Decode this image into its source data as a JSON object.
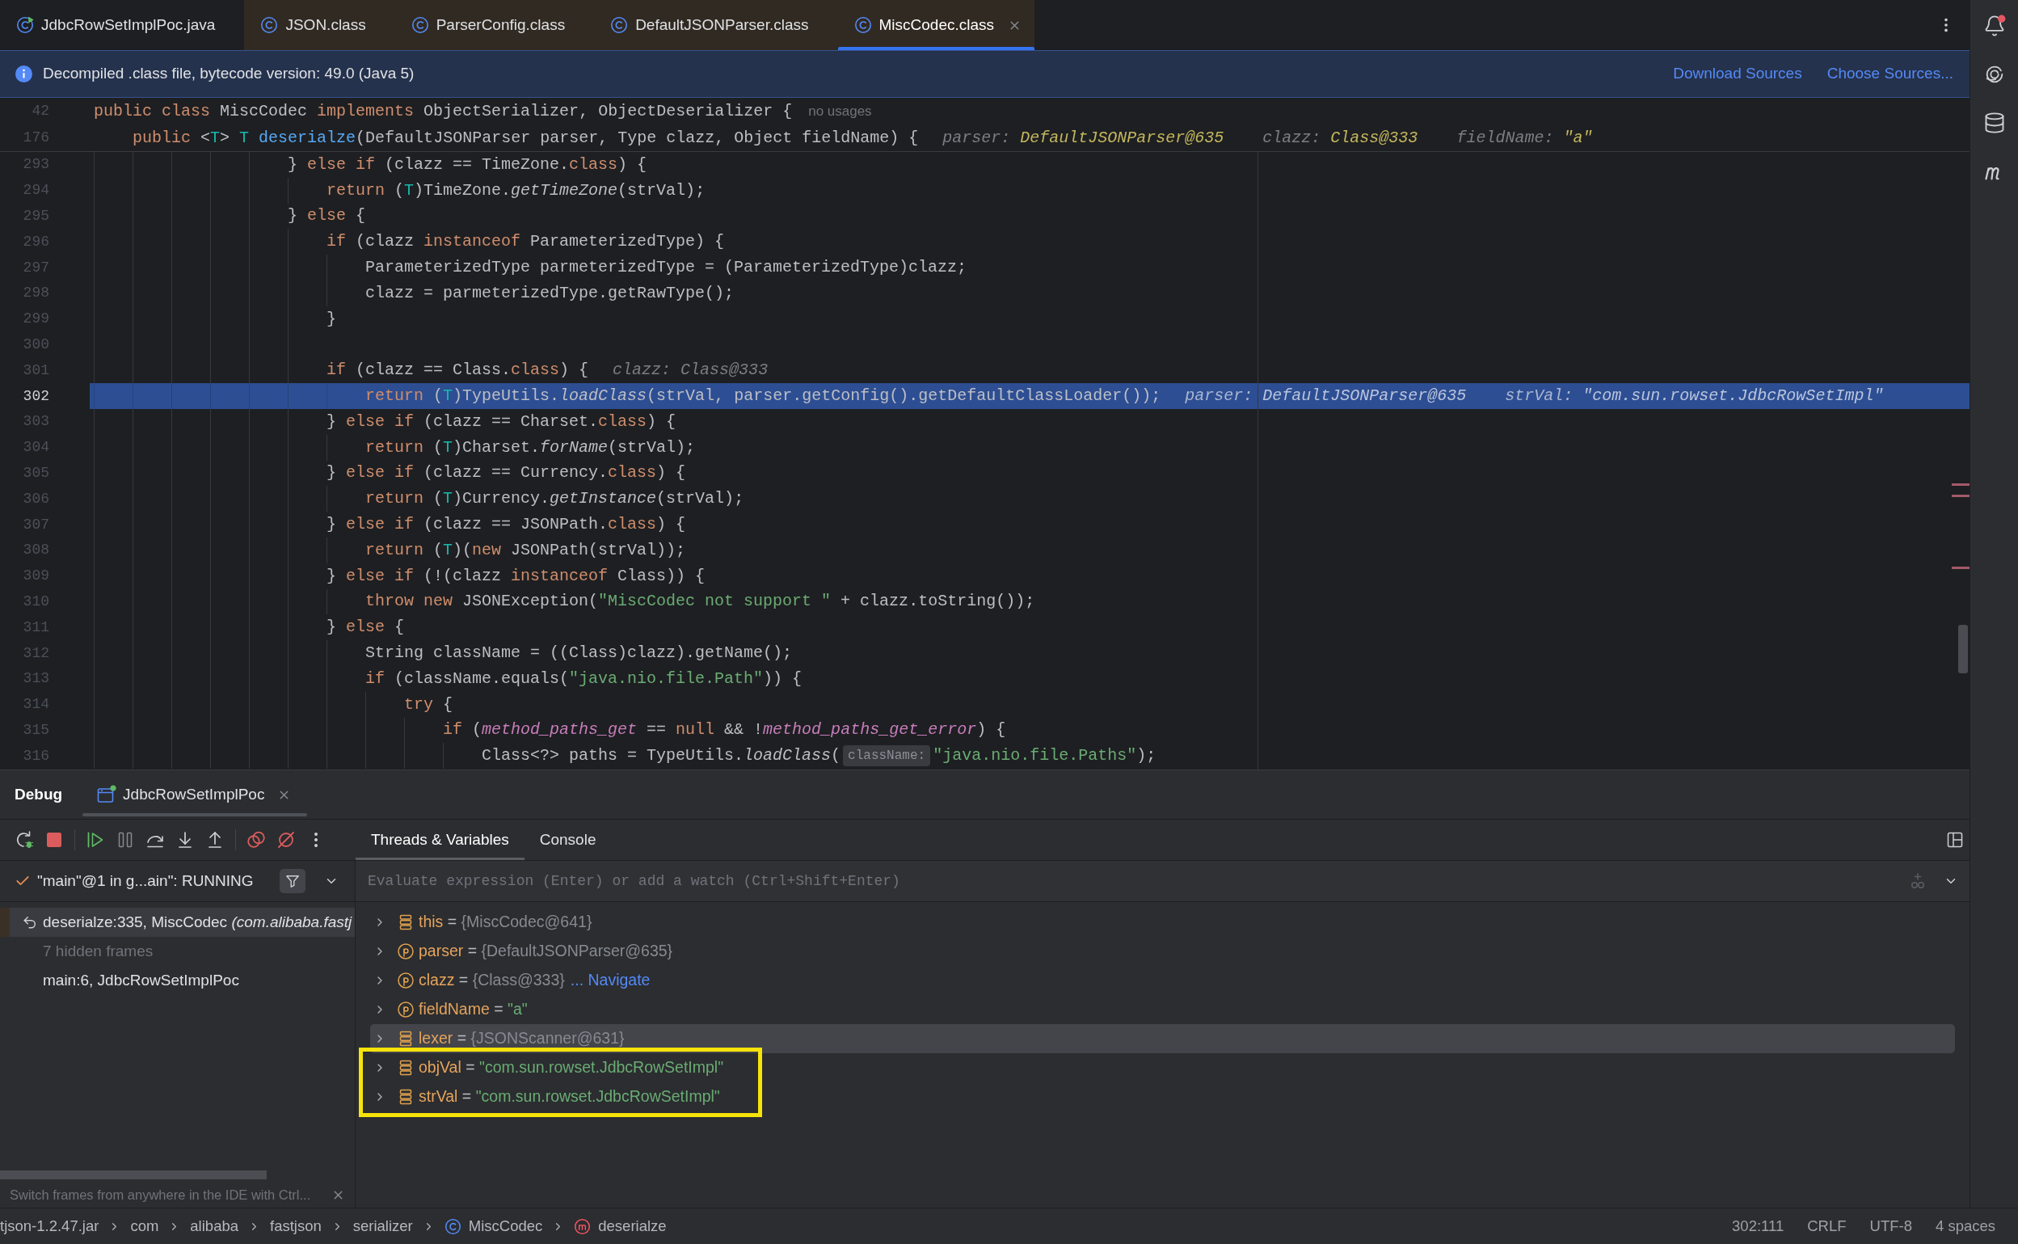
{
  "editor_tabs": [
    {
      "label": "JdbcRowSetImplPoc.java",
      "kind": "runnable-class",
      "selected": false,
      "closable": false
    },
    {
      "label": "JSON.class",
      "kind": "class",
      "selected": false,
      "closable": false,
      "color": "#312a22"
    },
    {
      "label": "ParserConfig.class",
      "kind": "class",
      "selected": false,
      "closable": false,
      "color": "#312a22"
    },
    {
      "label": "DefaultJSONParser.class",
      "kind": "class",
      "selected": false,
      "closable": false,
      "color": "#312a22"
    },
    {
      "label": "MiscCodec.class",
      "kind": "class",
      "selected": true,
      "closable": true,
      "color": "#312a22"
    }
  ],
  "banner": {
    "message": "Decompiled .class file, bytecode version: 49.0 (Java 5)",
    "links": [
      "Download Sources",
      "Choose Sources..."
    ]
  },
  "sticky_lines": [
    {
      "number": "42",
      "tokens": [
        {
          "kind": "keyword",
          "text": "public class "
        },
        {
          "kind": "plain",
          "text": "MiscCodec "
        },
        {
          "kind": "keyword",
          "text": "implements "
        },
        {
          "kind": "plain",
          "text": "ObjectSerializer, ObjectDeserializer {"
        }
      ],
      "hints": [
        {
          "kind": "usages",
          "text": "no usages"
        }
      ]
    },
    {
      "number": "176",
      "tokens": [
        {
          "kind": "keyword",
          "text": "    public "
        },
        {
          "kind": "plain",
          "text": "<"
        },
        {
          "kind": "type-param",
          "text": "T"
        },
        {
          "kind": "plain",
          "text": "> "
        },
        {
          "kind": "type-param",
          "text": "T"
        },
        {
          "kind": "method-decl",
          "text": " deserialze"
        },
        {
          "kind": "plain",
          "text": "(DefaultJSONParser parser, Type clazz, Object fieldName) {"
        }
      ],
      "hints": [
        {
          "kind": "value",
          "name": "parser:",
          "value": "DefaultJSONParser@635"
        },
        {
          "kind": "value",
          "name": "clazz:",
          "value": "Class@333"
        },
        {
          "kind": "value",
          "name": "fieldName:",
          "value": "\"a\""
        }
      ]
    }
  ],
  "code": {
    "lines": [
      {
        "number": "293",
        "current": false,
        "tokens": [
          {
            "kind": "plain",
            "text": "                    } "
          },
          {
            "kind": "keyword",
            "text": "else if "
          },
          {
            "kind": "plain",
            "text": "(clazz == TimeZone."
          },
          {
            "kind": "keyword",
            "text": "class"
          },
          {
            "kind": "plain",
            "text": ") {"
          }
        ]
      },
      {
        "number": "294",
        "current": false,
        "tokens": [
          {
            "kind": "keyword",
            "text": "                        return "
          },
          {
            "kind": "plain",
            "text": "("
          },
          {
            "kind": "type-param",
            "text": "T"
          },
          {
            "kind": "plain",
            "text": ")TimeZone."
          },
          {
            "kind": "static-call",
            "text": "getTimeZone"
          },
          {
            "kind": "plain",
            "text": "(strVal);"
          }
        ]
      },
      {
        "number": "295",
        "current": false,
        "tokens": [
          {
            "kind": "plain",
            "text": "                    } "
          },
          {
            "kind": "keyword",
            "text": "else "
          },
          {
            "kind": "plain",
            "text": "{"
          }
        ]
      },
      {
        "number": "296",
        "current": false,
        "tokens": [
          {
            "kind": "keyword",
            "text": "                        if "
          },
          {
            "kind": "plain",
            "text": "(clazz "
          },
          {
            "kind": "keyword",
            "text": "instanceof "
          },
          {
            "kind": "plain",
            "text": "ParameterizedType) {"
          }
        ]
      },
      {
        "number": "297",
        "current": false,
        "tokens": [
          {
            "kind": "plain",
            "text": "                            ParameterizedType parmeterizedType = (ParameterizedType)clazz;"
          }
        ]
      },
      {
        "number": "298",
        "current": false,
        "tokens": [
          {
            "kind": "plain",
            "text": "                            clazz = parmeterizedType.getRawType();"
          }
        ]
      },
      {
        "number": "299",
        "current": false,
        "tokens": [
          {
            "kind": "plain",
            "text": "                        }"
          }
        ]
      },
      {
        "number": "300",
        "current": false
      },
      {
        "number": "301",
        "current": false,
        "tokens": [
          {
            "kind": "keyword",
            "text": "                        if "
          },
          {
            "kind": "plain",
            "text": "(clazz == Class."
          },
          {
            "kind": "keyword",
            "text": "class"
          },
          {
            "kind": "plain",
            "text": ") {"
          }
        ],
        "hints": [
          {
            "kind": "value",
            "name": "clazz:",
            "value": "Class@333"
          }
        ]
      },
      {
        "number": "302",
        "current": true,
        "tokens": [
          {
            "kind": "keyword",
            "text": "                            return "
          },
          {
            "kind": "plain",
            "text": "("
          },
          {
            "kind": "type-param",
            "text": "T"
          },
          {
            "kind": "plain",
            "text": ")TypeUtils."
          },
          {
            "kind": "static-call",
            "text": "loadClass"
          },
          {
            "kind": "plain",
            "text": "(strVal, parser.getConfig().getDefaultClassLoader());"
          }
        ],
        "hints": [
          {
            "kind": "value",
            "name": "parser:",
            "value": "DefaultJSONParser@635"
          },
          {
            "kind": "value",
            "name": "strVal:",
            "value": "\"com.sun.rowset.JdbcRowSetImpl\""
          }
        ]
      },
      {
        "number": "303",
        "current": false,
        "tokens": [
          {
            "kind": "plain",
            "text": "                        } "
          },
          {
            "kind": "keyword",
            "text": "else if "
          },
          {
            "kind": "plain",
            "text": "(clazz == Charset."
          },
          {
            "kind": "keyword",
            "text": "class"
          },
          {
            "kind": "plain",
            "text": ") {"
          }
        ]
      },
      {
        "number": "304",
        "current": false,
        "tokens": [
          {
            "kind": "keyword",
            "text": "                            return "
          },
          {
            "kind": "plain",
            "text": "("
          },
          {
            "kind": "type-param",
            "text": "T"
          },
          {
            "kind": "plain",
            "text": ")Charset."
          },
          {
            "kind": "static-call",
            "text": "forName"
          },
          {
            "kind": "plain",
            "text": "(strVal);"
          }
        ]
      },
      {
        "number": "305",
        "current": false,
        "tokens": [
          {
            "kind": "plain",
            "text": "                        } "
          },
          {
            "kind": "keyword",
            "text": "else if "
          },
          {
            "kind": "plain",
            "text": "(clazz == Currency."
          },
          {
            "kind": "keyword",
            "text": "class"
          },
          {
            "kind": "plain",
            "text": ") {"
          }
        ]
      },
      {
        "number": "306",
        "current": false,
        "tokens": [
          {
            "kind": "keyword",
            "text": "                            return "
          },
          {
            "kind": "plain",
            "text": "("
          },
          {
            "kind": "type-param",
            "text": "T"
          },
          {
            "kind": "plain",
            "text": ")Currency."
          },
          {
            "kind": "static-call",
            "text": "getInstance"
          },
          {
            "kind": "plain",
            "text": "(strVal);"
          }
        ]
      },
      {
        "number": "307",
        "current": false,
        "tokens": [
          {
            "kind": "plain",
            "text": "                        } "
          },
          {
            "kind": "keyword",
            "text": "else if "
          },
          {
            "kind": "plain",
            "text": "(clazz == JSONPath."
          },
          {
            "kind": "keyword",
            "text": "class"
          },
          {
            "kind": "plain",
            "text": ") {"
          }
        ]
      },
      {
        "number": "308",
        "current": false,
        "tokens": [
          {
            "kind": "keyword",
            "text": "                            return "
          },
          {
            "kind": "plain",
            "text": "("
          },
          {
            "kind": "type-param",
            "text": "T"
          },
          {
            "kind": "plain",
            "text": ")("
          },
          {
            "kind": "keyword",
            "text": "new "
          },
          {
            "kind": "plain",
            "text": "JSONPath(strVal));"
          }
        ]
      },
      {
        "number": "309",
        "current": false,
        "tokens": [
          {
            "kind": "plain",
            "text": "                        } "
          },
          {
            "kind": "keyword",
            "text": "else if "
          },
          {
            "kind": "plain",
            "text": "(!(clazz "
          },
          {
            "kind": "keyword",
            "text": "instanceof "
          },
          {
            "kind": "plain",
            "text": "Class)) {"
          }
        ]
      },
      {
        "number": "310",
        "current": false,
        "tokens": [
          {
            "kind": "keyword",
            "text": "                            throw new "
          },
          {
            "kind": "plain",
            "text": "JSONException("
          },
          {
            "kind": "string",
            "text": "\"MiscCodec not support \""
          },
          {
            "kind": "plain",
            "text": " + clazz.toString());"
          }
        ]
      },
      {
        "number": "311",
        "current": false,
        "tokens": [
          {
            "kind": "plain",
            "text": "                        } "
          },
          {
            "kind": "keyword",
            "text": "else "
          },
          {
            "kind": "plain",
            "text": "{"
          }
        ]
      },
      {
        "number": "312",
        "current": false,
        "tokens": [
          {
            "kind": "plain",
            "text": "                            String className = ((Class)clazz).getName();"
          }
        ]
      },
      {
        "number": "313",
        "current": false,
        "tokens": [
          {
            "kind": "keyword",
            "text": "                            if "
          },
          {
            "kind": "plain",
            "text": "(className.equals("
          },
          {
            "kind": "string",
            "text": "\"java.nio.file.Path\""
          },
          {
            "kind": "plain",
            "text": ")) {"
          }
        ]
      },
      {
        "number": "314",
        "current": false,
        "tokens": [
          {
            "kind": "keyword",
            "text": "                                try "
          },
          {
            "kind": "plain",
            "text": "{"
          }
        ]
      },
      {
        "number": "315",
        "current": false,
        "tokens": [
          {
            "kind": "keyword",
            "text": "                                    if "
          },
          {
            "kind": "plain",
            "text": "("
          },
          {
            "kind": "static-field",
            "text": "method_paths_get"
          },
          {
            "kind": "plain",
            "text": " == "
          },
          {
            "kind": "keyword",
            "text": "null"
          },
          {
            "kind": "plain",
            "text": " && !"
          },
          {
            "kind": "static-field",
            "text": "method_paths_get_error"
          },
          {
            "kind": "plain",
            "text": ") {"
          }
        ]
      },
      {
        "number": "316",
        "current": false,
        "tokens": [
          {
            "kind": "plain",
            "text": "                                        Class<?> paths = TypeUtils."
          },
          {
            "kind": "static-call",
            "text": "loadClass"
          },
          {
            "kind": "plain",
            "text": "("
          },
          {
            "kind": "param-hint",
            "text": "className:"
          },
          {
            "kind": "string",
            "text": "\"java.nio.file.Paths\""
          },
          {
            "kind": "plain",
            "text": ");"
          }
        ]
      }
    ]
  },
  "debug": {
    "title": "Debug",
    "session_tab": {
      "label": "JdbcRowSetImplPoc",
      "selected": true
    },
    "view_tabs": [
      {
        "label": "Threads & Variables",
        "selected": true
      },
      {
        "label": "Console",
        "selected": false
      }
    ],
    "thread": {
      "label": "\"main\"@1 in g...ain\": RUNNING"
    },
    "frames": [
      {
        "kind": "top-frame",
        "label": "deserialze:335, MiscCodec",
        "package": "(com.alibaba.fastj",
        "selected": true
      },
      {
        "kind": "hidden-frames",
        "label": "7 hidden frames",
        "selected": false
      },
      {
        "kind": "frame",
        "label": "main:6, JdbcRowSetImplPoc",
        "selected": false
      }
    ],
    "frames_tip": "Switch frames from anywhere in the IDE with Ctrl...",
    "evaluate": {
      "placeholder": "Evaluate expression (Enter) or add a watch (Ctrl+Shift+Enter)"
    },
    "variables": [
      {
        "kind": "local",
        "name": "this",
        "sign": "=",
        "value": "{MiscCodec@641}",
        "is_string": false,
        "selected": false,
        "highlighted": false
      },
      {
        "kind": "param",
        "name": "parser",
        "sign": "=",
        "value": "{DefaultJSONParser@635}",
        "is_string": false,
        "selected": false,
        "highlighted": false
      },
      {
        "kind": "param",
        "name": "clazz",
        "sign": "=",
        "value": "{Class@333}",
        "is_string": false,
        "link": "... Navigate",
        "selected": false,
        "highlighted": false
      },
      {
        "kind": "param",
        "name": "fieldName",
        "sign": "=",
        "value": "\"a\"",
        "is_string": true,
        "selected": false,
        "highlighted": false
      },
      {
        "kind": "local",
        "name": "lexer",
        "sign": "=",
        "value": "{JSONScanner@631}",
        "is_string": false,
        "selected": true,
        "highlighted": false
      },
      {
        "kind": "local",
        "name": "objVal",
        "sign": "=",
        "value": "\"com.sun.rowset.JdbcRowSetImpl\"",
        "is_string": true,
        "selected": false,
        "highlighted": true
      },
      {
        "kind": "local",
        "name": "strVal",
        "sign": "=",
        "value": "\"com.sun.rowset.JdbcRowSetImpl\"",
        "is_string": true,
        "selected": false,
        "highlighted": true
      }
    ]
  },
  "status_bar": {
    "breadcrumbs": [
      {
        "label": "tjson-1.2.47.jar",
        "kind": "package"
      },
      {
        "label": "com",
        "kind": "package"
      },
      {
        "label": "alibaba",
        "kind": "package"
      },
      {
        "label": "fastjson",
        "kind": "package"
      },
      {
        "label": "serializer",
        "kind": "package"
      },
      {
        "label": "MiscCodec",
        "kind": "class"
      },
      {
        "label": "deserialze",
        "kind": "method"
      }
    ],
    "indicators": [
      "302:111",
      "CRLF",
      "UTF-8",
      "4 spaces"
    ]
  },
  "tool_strip": {
    "notification_dot": true
  }
}
